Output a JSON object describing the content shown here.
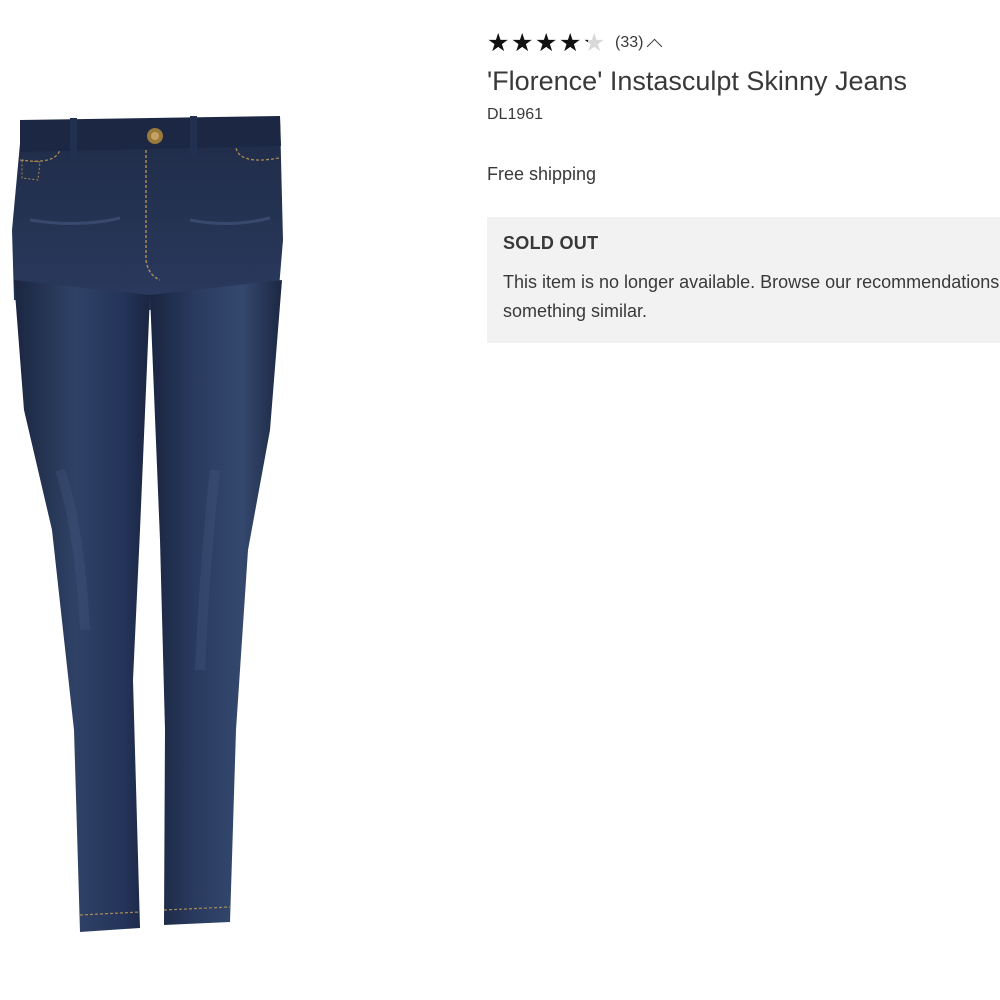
{
  "product": {
    "rating": 4.2,
    "rating_max": 5,
    "review_count": "(33)",
    "title": "'Florence' Instasculpt Skinny Jeans",
    "brand": "DL1961",
    "shipping": "Free shipping",
    "image_icon": "skinny-jeans-photo"
  },
  "availability": {
    "status": "SOLD OUT",
    "message": "This item is no longer available. Browse our recommendations for something similar."
  },
  "colors": {
    "denim_dark": "#1e2a45",
    "denim_mid": "#2b3b5e",
    "denim_light": "#3d5078",
    "star_filled": "#111111",
    "star_empty": "#d9d9d9",
    "banner_bg": "#f2f2f2"
  }
}
